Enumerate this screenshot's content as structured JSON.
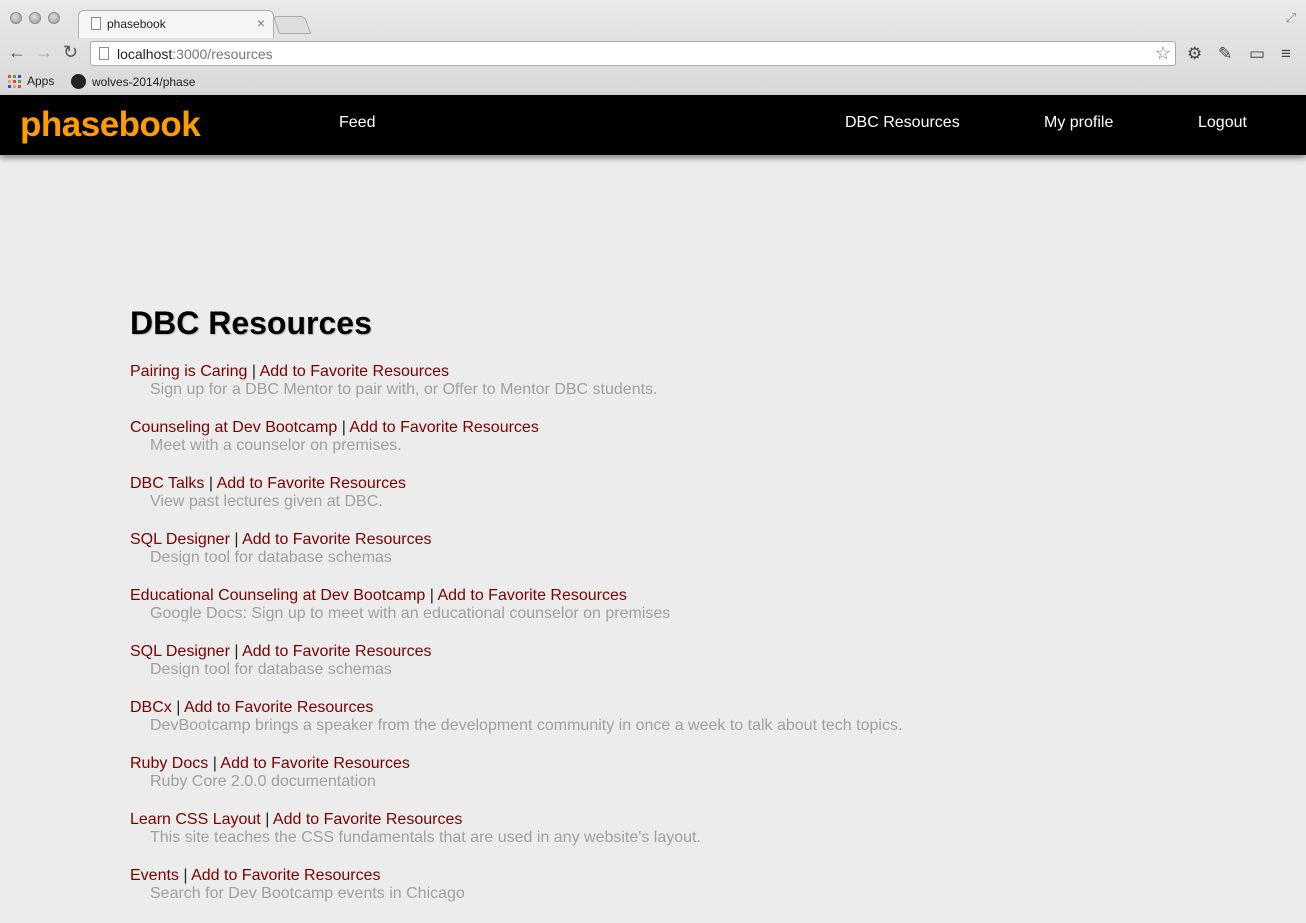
{
  "browser": {
    "tab_title": "phasebook",
    "tab_close": "×",
    "url_host": "localhost",
    "url_path": ":3000/resources",
    "bookmarks": [
      {
        "label": "Apps",
        "icon": "apps-grid-icon"
      },
      {
        "label": "wolves-2014/phase",
        "icon": "github-icon"
      }
    ]
  },
  "nav": {
    "brand": "phasebook",
    "feed": "Feed",
    "resources": "DBC Resources",
    "profile": "My profile",
    "logout": "Logout"
  },
  "page": {
    "heading": "DBC Resources",
    "separator": "|",
    "favorite_label": "Add to Favorite Resources",
    "resources": [
      {
        "name": "Pairing is Caring",
        "description": "Sign up for a DBC Mentor to pair with, or Offer to Mentor DBC students."
      },
      {
        "name": "Counseling at Dev Bootcamp",
        "description": "Meet with a counselor on premises."
      },
      {
        "name": "DBC Talks",
        "description": "View past lectures given at DBC."
      },
      {
        "name": "SQL Designer",
        "description": "Design tool for database schemas"
      },
      {
        "name": "Educational Counseling at Dev Bootcamp",
        "description": "Google Docs: Sign up to meet with an educational counselor on premises"
      },
      {
        "name": "SQL Designer",
        "description": "Design tool for database schemas"
      },
      {
        "name": "DBCx",
        "description": "DevBootcamp brings a speaker from the development community in once a week to talk about tech topics."
      },
      {
        "name": "Ruby Docs",
        "description": "Ruby Core 2.0.0 documentation"
      },
      {
        "name": "Learn CSS Layout",
        "description": "This site teaches the CSS fundamentals that are used in any website's layout."
      },
      {
        "name": "Events",
        "description": "Search for Dev Bootcamp events in Chicago"
      }
    ]
  },
  "colors": {
    "brand": "#ff9c00",
    "navbar": "#000000",
    "link": "#7a0000",
    "description": "#a0a0a0",
    "background": "#ececec"
  }
}
